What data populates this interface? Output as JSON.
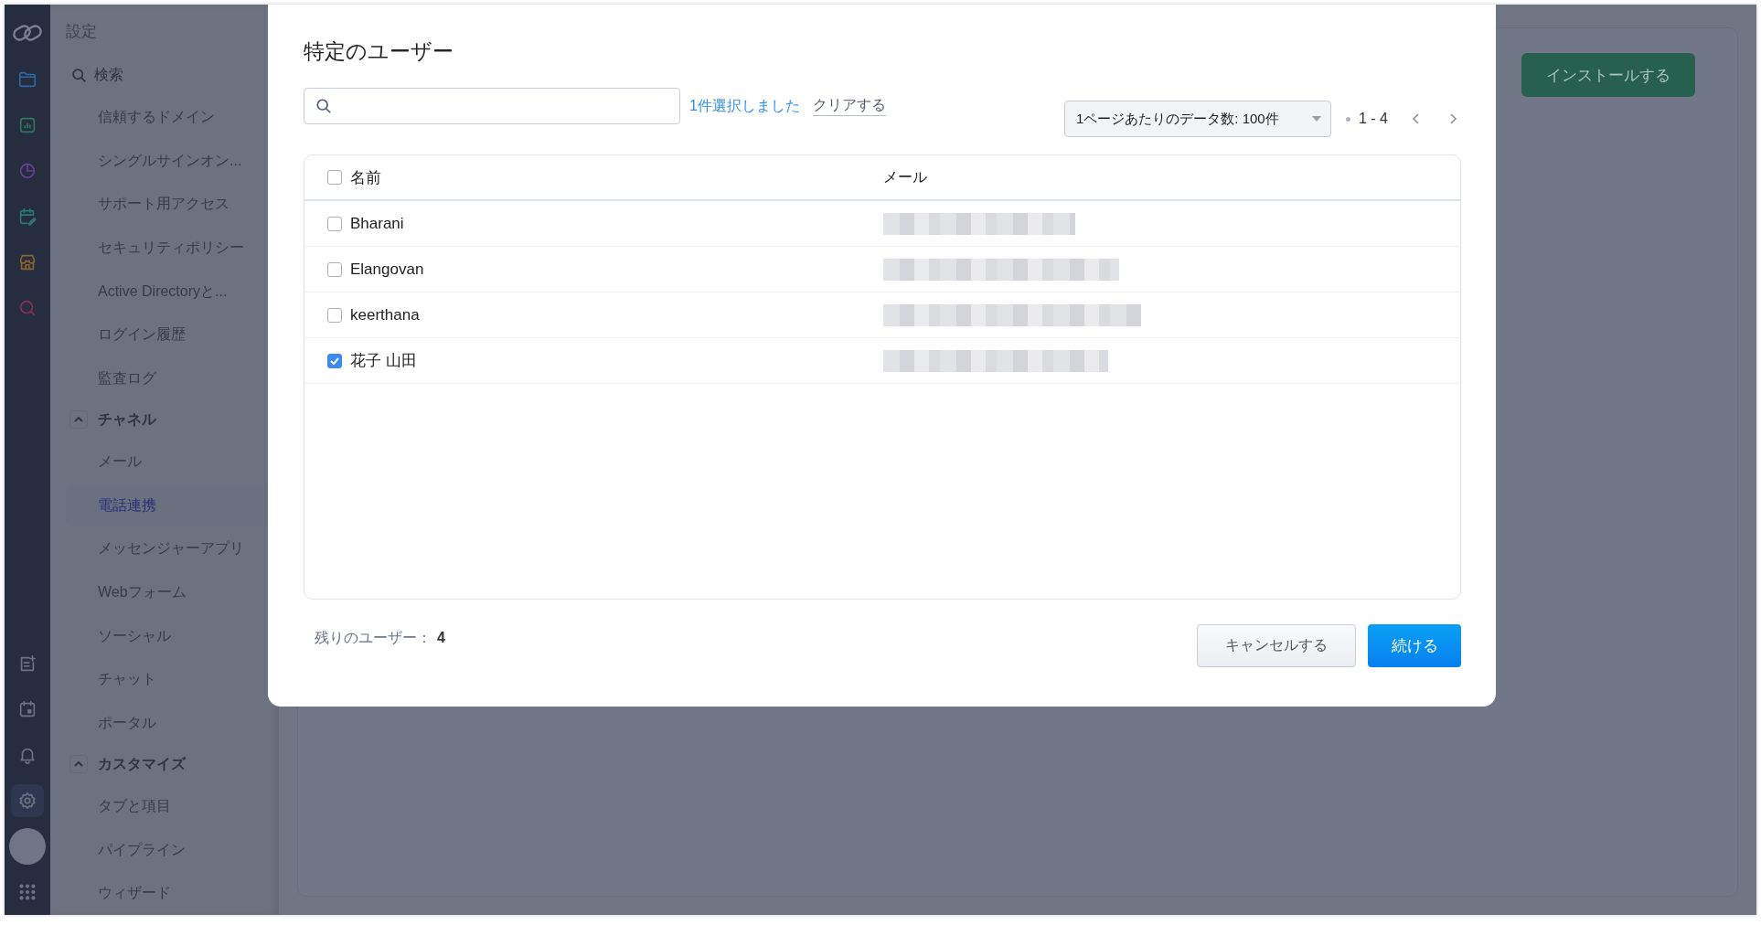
{
  "rail": {
    "top_items": [
      {
        "kind": "folder",
        "selected": false
      },
      {
        "kind": "chart",
        "selected": false
      },
      {
        "kind": "pie",
        "selected": false
      },
      {
        "kind": "calendar-edit",
        "selected": false
      },
      {
        "kind": "store",
        "selected": false
      },
      {
        "kind": "search",
        "selected": false
      }
    ],
    "bottom_items": [
      {
        "kind": "note-add",
        "selected": false
      },
      {
        "kind": "calendar",
        "selected": false
      },
      {
        "kind": "bell",
        "selected": false
      },
      {
        "kind": "gear",
        "selected": true
      },
      {
        "kind": "avatar",
        "selected": false
      },
      {
        "kind": "apps",
        "selected": false
      }
    ]
  },
  "sidebar": {
    "title": "設定",
    "search_placeholder": "検索",
    "items": [
      {
        "label": "信頼するドメイン",
        "selected": false
      },
      {
        "label": "シングルサインオン...",
        "selected": false
      },
      {
        "label": "サポート用アクセス",
        "selected": false
      },
      {
        "label": "セキュリティポリシー",
        "selected": false
      },
      {
        "label": "Active Directoryと...",
        "selected": false
      },
      {
        "label": "ログイン履歴",
        "selected": false
      },
      {
        "label": "監査ログ",
        "selected": false
      }
    ],
    "sections": [
      {
        "title": "チャネル",
        "expanded": true,
        "items": [
          {
            "label": "メール",
            "selected": false
          },
          {
            "label": "電話連携",
            "selected": true
          },
          {
            "label": "メッセンジャーアプリ",
            "selected": false
          },
          {
            "label": "Webフォーム",
            "selected": false
          },
          {
            "label": "ソーシャル",
            "selected": false
          },
          {
            "label": "チャット",
            "selected": false
          },
          {
            "label": "ポータル",
            "selected": false
          }
        ]
      },
      {
        "title": "カスタマイズ",
        "expanded": true,
        "items": [
          {
            "label": "タブと項目",
            "selected": false
          },
          {
            "label": "パイプライン",
            "selected": false
          },
          {
            "label": "ウィザード",
            "selected": false
          }
        ]
      }
    ]
  },
  "main": {
    "install_button": "インストールする"
  },
  "modal": {
    "title": "特定のユーザー",
    "selection_text": "1件選択しました",
    "clear_link": "クリアする",
    "page_size": "1ページあたりのデータ数: 100件",
    "range": "1 - 4",
    "table": {
      "select_all_checked": false,
      "columns": [
        "名前",
        "メール"
      ],
      "rows": [
        {
          "name": "Bharani",
          "checked": false
        },
        {
          "name": "Elangovan",
          "checked": false
        },
        {
          "name": "keerthana",
          "checked": false
        },
        {
          "name": "花子 山田",
          "checked": true
        }
      ]
    },
    "remaining_label": "残りのユーザー：",
    "remaining_count": "4",
    "cancel_button": "キャンセルする",
    "continue_button": "続ける"
  }
}
